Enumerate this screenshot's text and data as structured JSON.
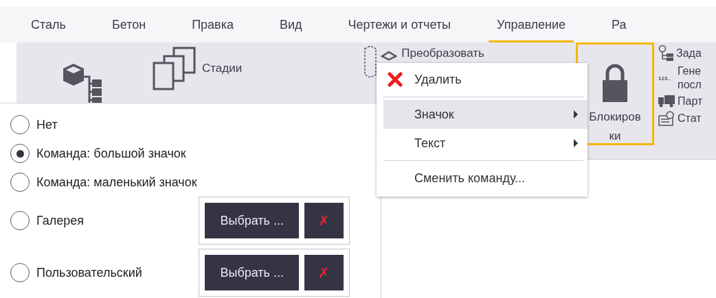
{
  "tabs": [
    {
      "label": "Сталь",
      "selected": false
    },
    {
      "label": "Бетон",
      "selected": false
    },
    {
      "label": "Правка",
      "selected": false
    },
    {
      "label": "Вид",
      "selected": false
    },
    {
      "label": "Чертежи и отчеты",
      "selected": false
    },
    {
      "label": "Управление",
      "selected": true
    },
    {
      "label": "Ра",
      "selected": false
    }
  ],
  "ribbon": {
    "stages_label": "Стадии",
    "convert_label": "Преобразовать",
    "lock": {
      "label": "Блокировки",
      "highlighted": true
    },
    "side_items": [
      {
        "kind": "task",
        "lines": [
          "Зада"
        ]
      },
      {
        "kind": "numbering",
        "badge": "123..",
        "lines": [
          "Гене",
          "посл"
        ]
      },
      {
        "kind": "truck",
        "lines": [
          "Парт"
        ]
      },
      {
        "kind": "status",
        "lines": [
          "Стат"
        ]
      }
    ]
  },
  "context_menu": [
    {
      "kind": "delete",
      "label": "Удалить"
    },
    {
      "kind": "separator"
    },
    {
      "kind": "submenu",
      "label": "Значок",
      "selected": true
    },
    {
      "kind": "submenu",
      "label": "Текст",
      "selected": false
    },
    {
      "kind": "separator"
    },
    {
      "kind": "command",
      "label": "Сменить команду..."
    }
  ],
  "icon_options": [
    {
      "label": "Нет",
      "selected": false
    },
    {
      "label": "Команда: большой значок",
      "selected": true
    },
    {
      "label": "Команда: маленький значок",
      "selected": false
    },
    {
      "label": "Галерея",
      "selected": false,
      "choose_button": "Выбрать ...",
      "clear_button": "✗"
    },
    {
      "label": "Пользовательский",
      "selected": false,
      "choose_button": "Выбрать ...",
      "clear_button": "✗"
    }
  ]
}
